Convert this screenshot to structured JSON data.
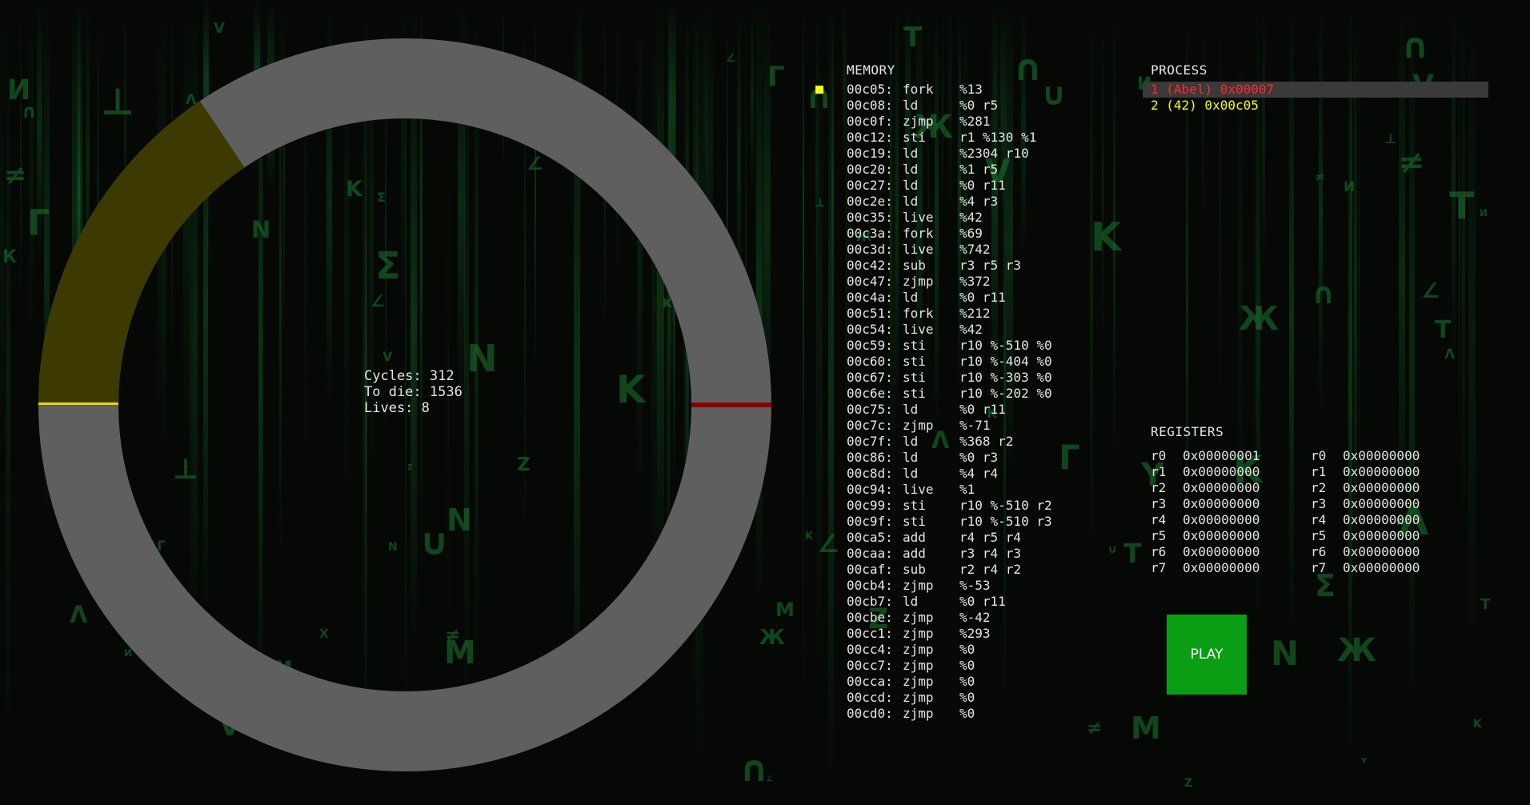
{
  "colors": {
    "ring_empty": "#5f5f5f",
    "ring_player1": "#3d3a00",
    "ring_marker1": "#e0d900",
    "ring_marker2": "#8a0000",
    "process_selected": "#ff2a2a",
    "process_other": "#ffff00",
    "pc_marker": "#ffff00",
    "play_bg": "#0a9e14"
  },
  "ring": {
    "segments": [
      {
        "owner": "player-2",
        "start_deg": 180,
        "end_deg": 236,
        "color": "#3d3a00"
      }
    ]
  },
  "info": {
    "cycles": "Cycles: 312",
    "to_die": "To die: 1536",
    "lives": "Lives: 8"
  },
  "memory": {
    "title": "MEMORY",
    "rows": [
      {
        "addr": "00c05:",
        "op": "fork",
        "args": "%13"
      },
      {
        "addr": "00c08:",
        "op": "ld",
        "args": "%0 r5"
      },
      {
        "addr": "00c0f:",
        "op": "zjmp",
        "args": "%281"
      },
      {
        "addr": "00c12:",
        "op": "sti",
        "args": "r1 %130 %1"
      },
      {
        "addr": "00c19:",
        "op": "ld",
        "args": "%2304 r10"
      },
      {
        "addr": "00c20:",
        "op": "ld",
        "args": "%1 r5"
      },
      {
        "addr": "00c27:",
        "op": "ld",
        "args": "%0 r11"
      },
      {
        "addr": "00c2e:",
        "op": "ld",
        "args": "%4 r3"
      },
      {
        "addr": "00c35:",
        "op": "live",
        "args": "%42"
      },
      {
        "addr": "00c3a:",
        "op": "fork",
        "args": "%69"
      },
      {
        "addr": "00c3d:",
        "op": "live",
        "args": "%742"
      },
      {
        "addr": "00c42:",
        "op": "sub",
        "args": "r3 r5 r3"
      },
      {
        "addr": "00c47:",
        "op": "zjmp",
        "args": "%372"
      },
      {
        "addr": "00c4a:",
        "op": "ld",
        "args": "%0 r11"
      },
      {
        "addr": "00c51:",
        "op": "fork",
        "args": "%212"
      },
      {
        "addr": "00c54:",
        "op": "live",
        "args": "%42"
      },
      {
        "addr": "00c59:",
        "op": "sti",
        "args": "r10 %-510 %0"
      },
      {
        "addr": "00c60:",
        "op": "sti",
        "args": "r10 %-404 %0"
      },
      {
        "addr": "00c67:",
        "op": "sti",
        "args": "r10 %-303 %0"
      },
      {
        "addr": "00c6e:",
        "op": "sti",
        "args": "r10 %-202 %0"
      },
      {
        "addr": "00c75:",
        "op": "ld",
        "args": "%0 r11"
      },
      {
        "addr": "00c7c:",
        "op": "zjmp",
        "args": "%-71"
      },
      {
        "addr": "00c7f:",
        "op": "ld",
        "args": "%368 r2"
      },
      {
        "addr": "00c86:",
        "op": "ld",
        "args": "%0 r3"
      },
      {
        "addr": "00c8d:",
        "op": "ld",
        "args": "%4 r4"
      },
      {
        "addr": "00c94:",
        "op": "live",
        "args": "%1"
      },
      {
        "addr": "00c99:",
        "op": "sti",
        "args": "r10 %-510 r2"
      },
      {
        "addr": "00c9f:",
        "op": "sti",
        "args": "r10 %-510 r3"
      },
      {
        "addr": "00ca5:",
        "op": "add",
        "args": "r4 r5 r4"
      },
      {
        "addr": "00caa:",
        "op": "add",
        "args": "r3 r4 r3"
      },
      {
        "addr": "00caf:",
        "op": "sub",
        "args": "r2 r4 r2"
      },
      {
        "addr": "00cb4:",
        "op": "zjmp",
        "args": "%-53"
      },
      {
        "addr": "00cb7:",
        "op": "ld",
        "args": "%0 r11"
      },
      {
        "addr": "00cbe:",
        "op": "zjmp",
        "args": "%-42"
      },
      {
        "addr": "00cc1:",
        "op": "zjmp",
        "args": "%293"
      },
      {
        "addr": "00cc4:",
        "op": "zjmp",
        "args": "%0"
      },
      {
        "addr": "00cc7:",
        "op": "zjmp",
        "args": "%0"
      },
      {
        "addr": "00cca:",
        "op": "zjmp",
        "args": "%0"
      },
      {
        "addr": "00ccd:",
        "op": "zjmp",
        "args": "%0"
      },
      {
        "addr": "00cd0:",
        "op": "zjmp",
        "args": "%0"
      }
    ]
  },
  "process": {
    "title": "PROCESS",
    "rows": [
      {
        "text": "1 (Abel) 0x00007",
        "color": "#ff2a2a",
        "selected": true
      },
      {
        "text": "2 (42) 0x00c05",
        "color": "#ffff00",
        "selected": false
      }
    ]
  },
  "registers": {
    "title": "REGISTERS",
    "rows": [
      {
        "a_name": "r0",
        "a_val": "0x00000001",
        "b_name": "r0",
        "b_val": "0x00000000"
      },
      {
        "a_name": "r1",
        "a_val": "0x00000000",
        "b_name": "r1",
        "b_val": "0x00000000"
      },
      {
        "a_name": "r2",
        "a_val": "0x00000000",
        "b_name": "r2",
        "b_val": "0x00000000"
      },
      {
        "a_name": "r3",
        "a_val": "0x00000000",
        "b_name": "r3",
        "b_val": "0x00000000"
      },
      {
        "a_name": "r4",
        "a_val": "0x00000000",
        "b_name": "r4",
        "b_val": "0x00000000"
      },
      {
        "a_name": "r5",
        "a_val": "0x00000000",
        "b_name": "r5",
        "b_val": "0x00000000"
      },
      {
        "a_name": "r6",
        "a_val": "0x00000000",
        "b_name": "r6",
        "b_val": "0x00000000"
      },
      {
        "a_name": "r7",
        "a_val": "0x00000000",
        "b_name": "r7",
        "b_val": "0x00000000"
      }
    ]
  },
  "play": {
    "label": "PLAY"
  }
}
